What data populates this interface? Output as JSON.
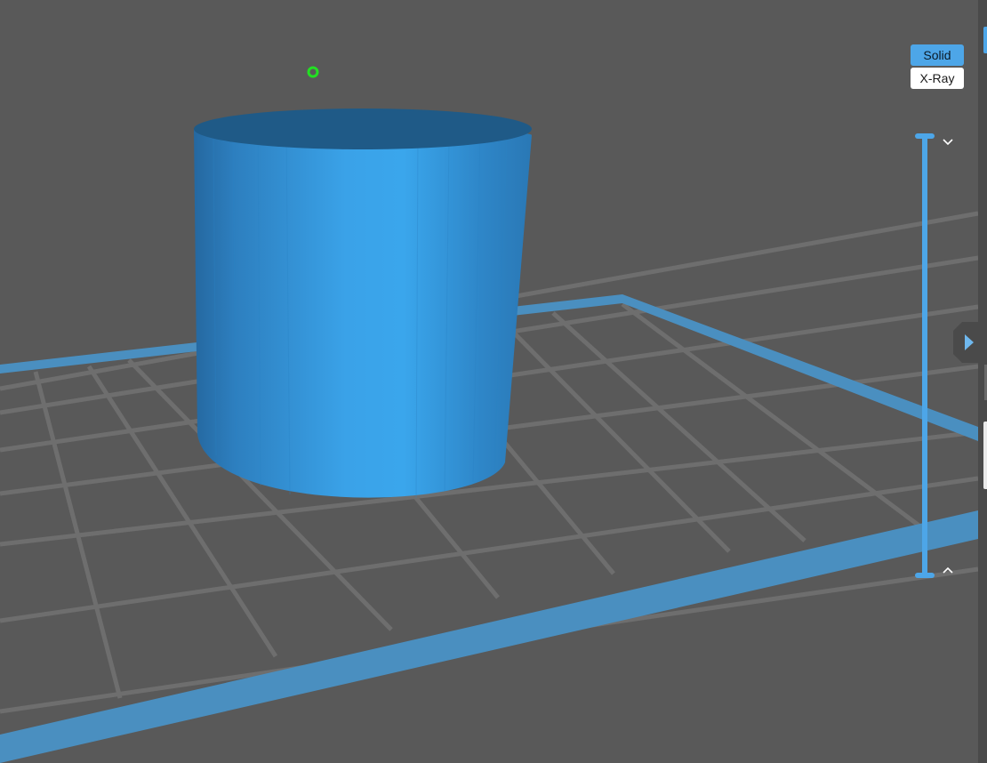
{
  "view_modes": {
    "solid_label": "Solid",
    "xray_label": "X-Ray",
    "active": "Solid"
  },
  "colors": {
    "background": "#595959",
    "accent": "#4da6e8",
    "grid_line": "#6e6e6e",
    "plate_border": "#4a8fc0",
    "model_top": "#1f5a87",
    "model_side_light": "#3ba3ea",
    "model_side_dark": "#2573b0",
    "pivot_marker": "#22e022"
  },
  "icons": {
    "slider_down": "chevron-down-icon",
    "slider_up": "chevron-up-icon",
    "panel_toggle": "triangle-right-icon",
    "pivot": "circle-marker-icon"
  },
  "scene": {
    "model_shape": "cylinder",
    "view": "perspective"
  }
}
